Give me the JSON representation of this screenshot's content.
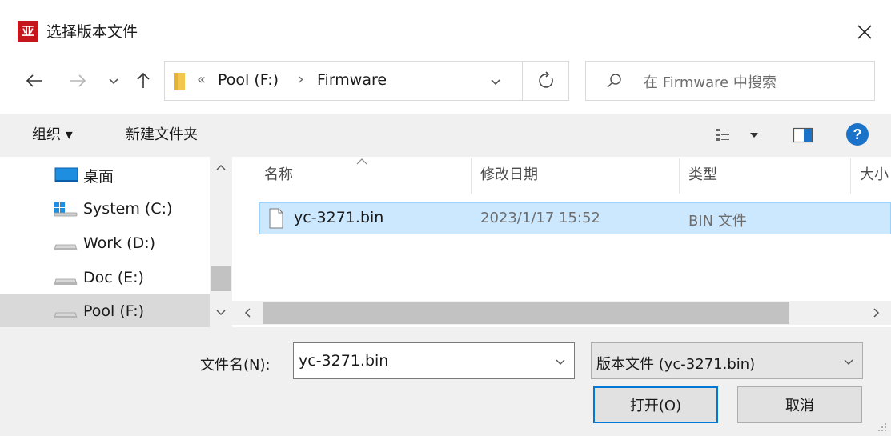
{
  "window": {
    "title": "选择版本文件",
    "app_icon_text": "亚"
  },
  "address": {
    "chevron": "«",
    "path": [
      "Pool (F:)",
      "Firmware"
    ],
    "separator": "›"
  },
  "search": {
    "placeholder": "在 Firmware 中搜索"
  },
  "toolbar": {
    "organize_label": "组织 ▾",
    "new_folder_label": "新建文件夹"
  },
  "nav_pane": {
    "items": [
      {
        "label": "桌面",
        "icon": "desktop-icon"
      },
      {
        "label": "System (C:)",
        "icon": "windows-drive-icon"
      },
      {
        "label": "Work (D:)",
        "icon": "drive-icon"
      },
      {
        "label": "Doc (E:)",
        "icon": "drive-icon"
      },
      {
        "label": "Pool (F:)",
        "icon": "drive-icon",
        "selected": true
      }
    ]
  },
  "file_list": {
    "columns": [
      "名称",
      "修改日期",
      "类型",
      "大小"
    ],
    "rows": [
      {
        "name": "yc-3271.bin",
        "modified": "2023/1/17 15:52",
        "type": "BIN 文件",
        "selected": true
      }
    ]
  },
  "bottom": {
    "filename_label": "文件名(N):",
    "filename_value": "yc-3271.bin",
    "filetype_value": "版本文件 (yc-3271.bin)",
    "open_label": "打开(O)",
    "cancel_label": "取消"
  },
  "colors": {
    "selection_bg": "#cce8ff",
    "primary_border": "#0078d7",
    "app_icon_bg": "#c4161c",
    "help_blue": "#1a73c9"
  }
}
